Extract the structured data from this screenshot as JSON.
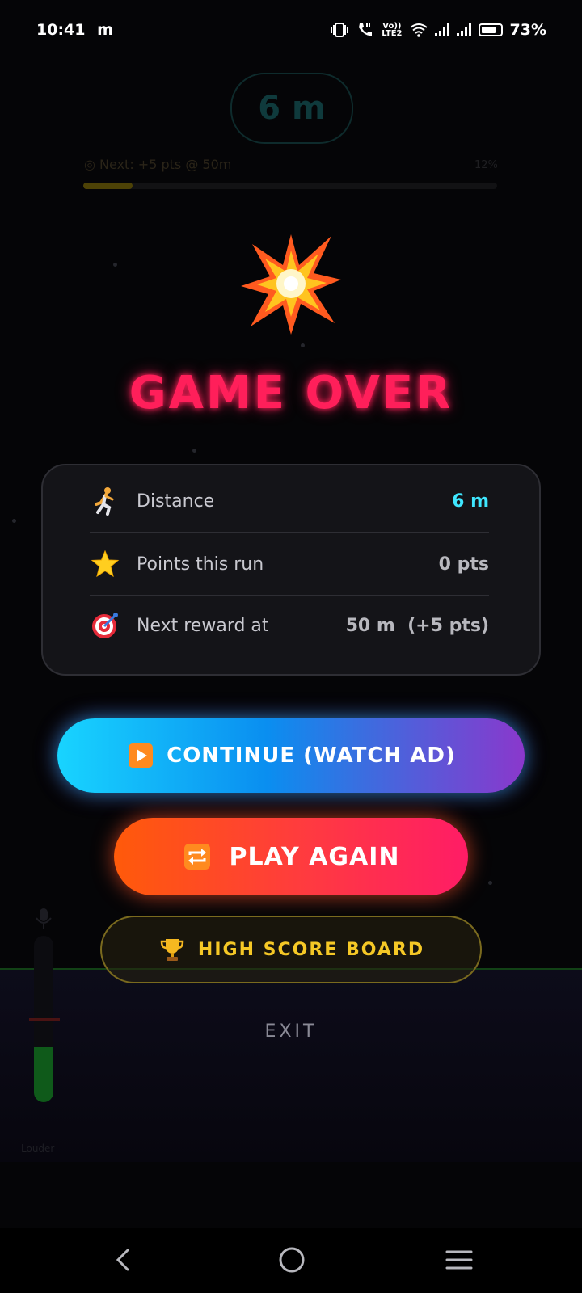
{
  "status_bar": {
    "time": "10:41",
    "carrier_icon": "m",
    "volte_label": "Vo))",
    "lte_label": "LTE2",
    "battery": "73%"
  },
  "hud": {
    "distance": "6 m",
    "next_label": "Next: +5 pts @ 50m",
    "progress_percent": "12%",
    "progress_fraction": 0.12,
    "mic_label": "Louder"
  },
  "overlay": {
    "title": "GAME OVER",
    "stats": [
      {
        "icon": "runner-icon",
        "label": "Distance",
        "value": "6 m",
        "color": "#3fe7ff"
      },
      {
        "icon": "star-icon",
        "label": "Points this run",
        "value": "0 pts",
        "color": "#b8b8be"
      },
      {
        "icon": "target-icon",
        "label": "Next reward at",
        "value": "50 m  (+5 pts)",
        "color": "#b8b8be"
      }
    ],
    "buttons": {
      "continue": "CONTINUE (WATCH AD)",
      "play_again": "PLAY AGAIN",
      "high_score": "HIGH SCORE BOARD",
      "exit": "EXIT"
    }
  },
  "colors": {
    "title": "#ff1f5a",
    "accent_cyan": "#3fe7ff",
    "gold": "#f5c826"
  }
}
